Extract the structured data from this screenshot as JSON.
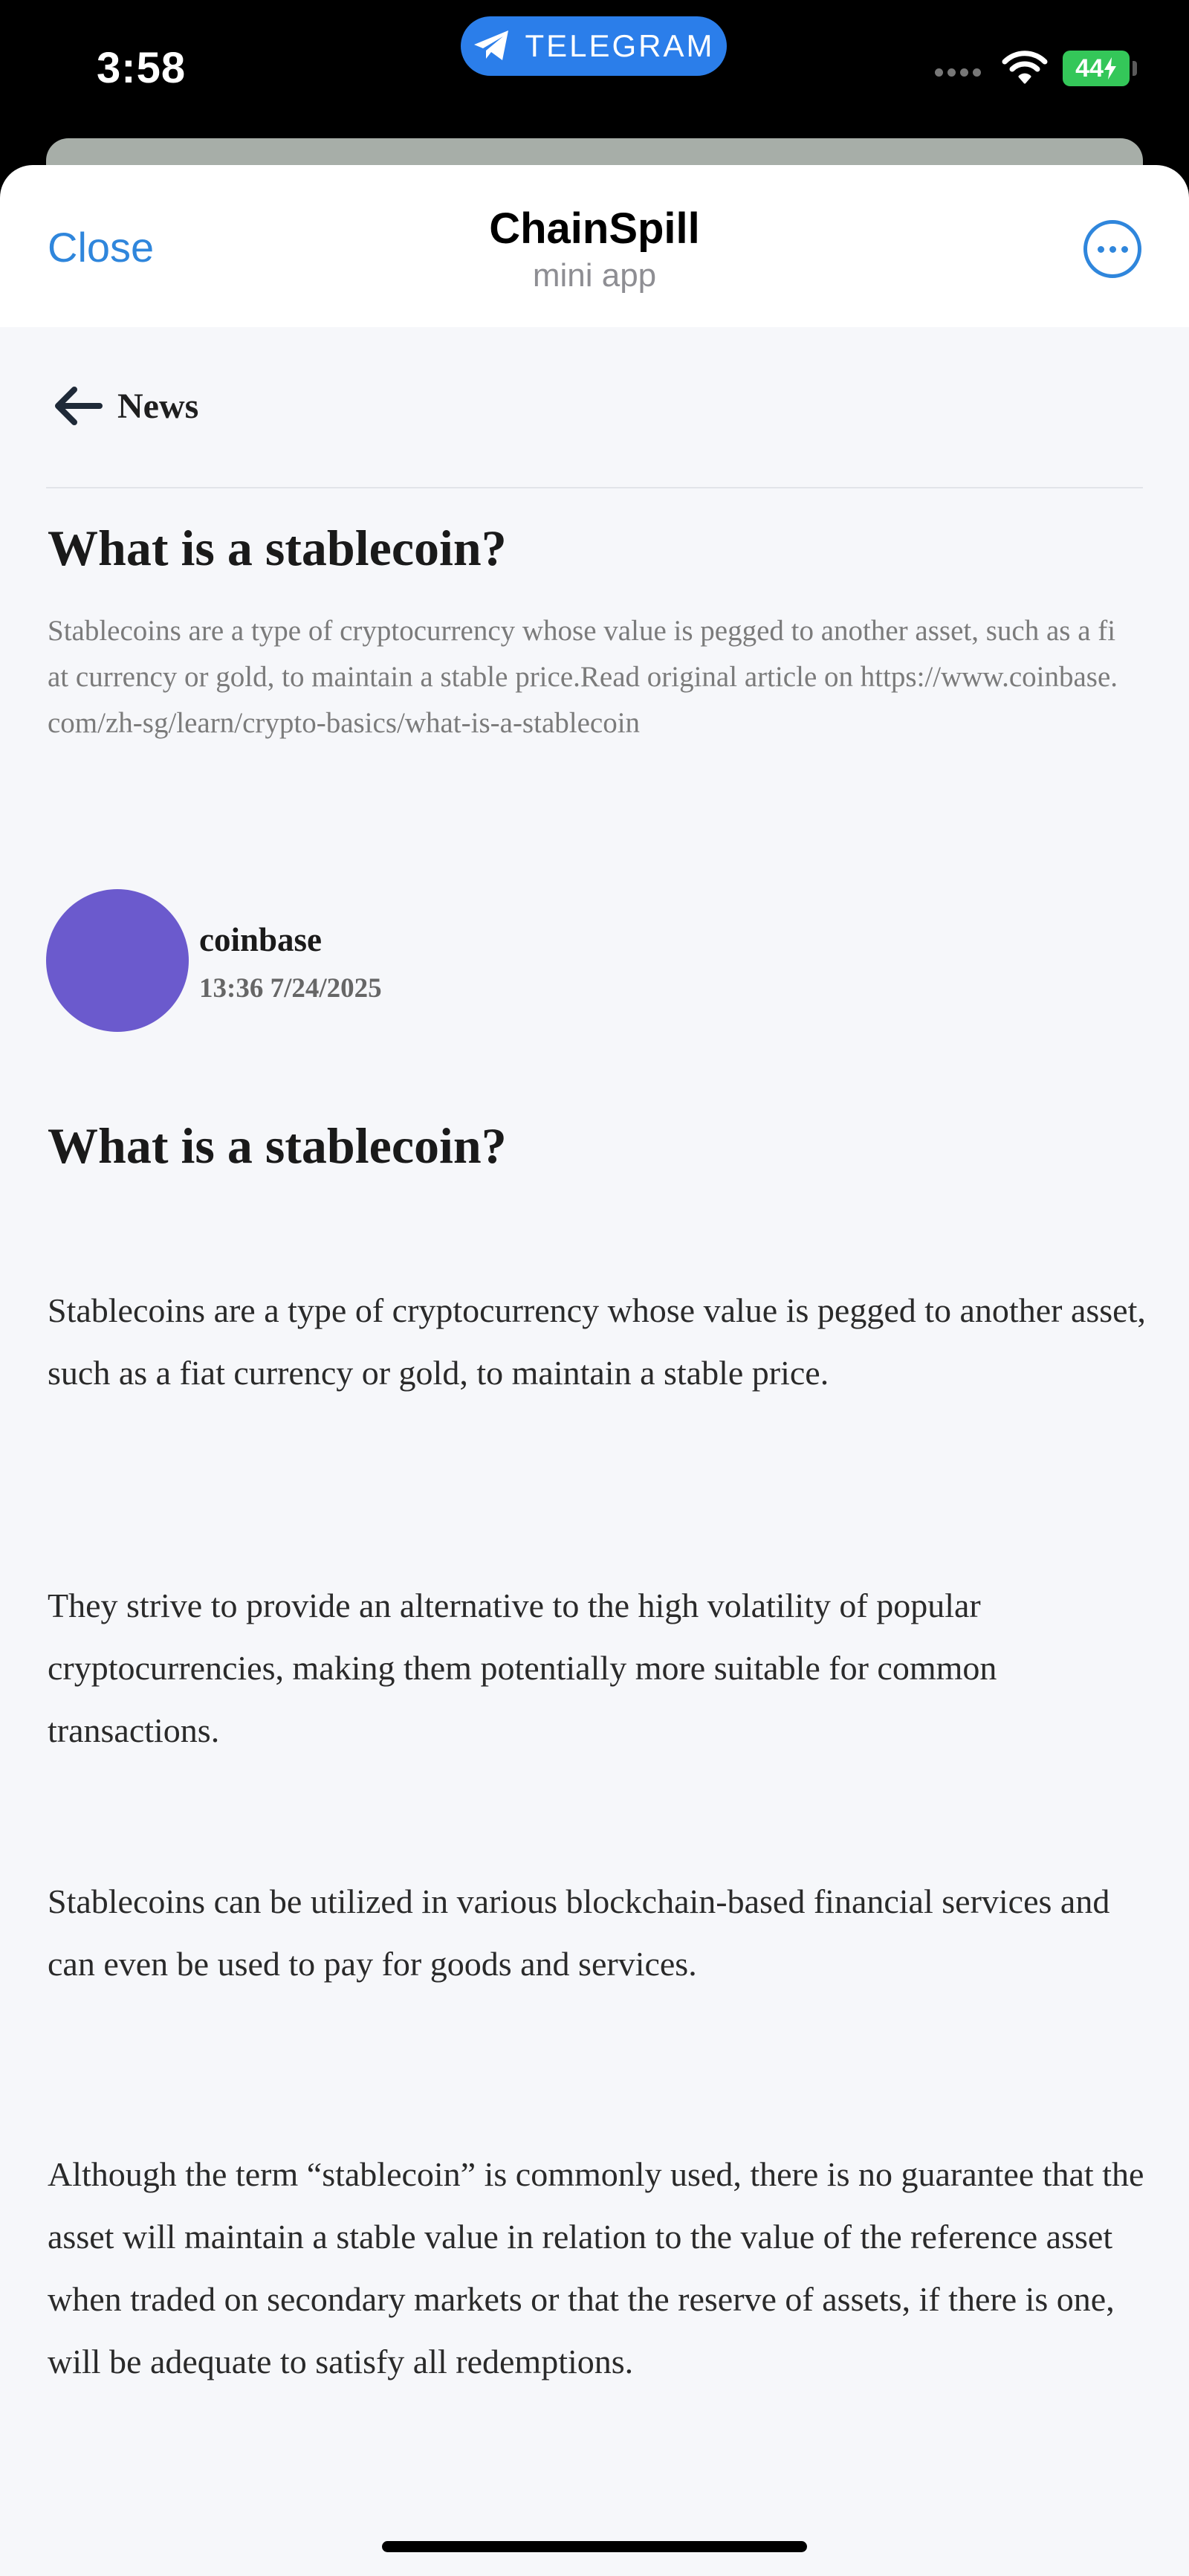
{
  "status_bar": {
    "time": "3:58",
    "app_pill_label": "TELEGRAM",
    "battery_level": "44"
  },
  "header": {
    "close_label": "Close",
    "title": "ChainSpill",
    "subtitle": "mini app",
    "more_icon": "more-horizontal-circle-icon"
  },
  "nav": {
    "back_label": "News",
    "back_icon": "arrow-left-icon"
  },
  "article": {
    "title": "What is a stablecoin?",
    "summary": "Stablecoins are a type of cryptocurrency whose value is pegged to another asset, such as a fiat currency or gold, to maintain a stable price.Read original article on https://www.coinbase.com/zh-sg/learn/crypto-basics/what-is-a-stablecoin",
    "author": {
      "name": "coinbase",
      "date": "13:36 7/24/2025",
      "avatar_color": "#6B5ACD"
    },
    "body_title": "What is a stablecoin?",
    "paragraphs": [
      "Stablecoins are a type of cryptocurrency whose value is pegged to another asset, such as a fiat currency or gold, to maintain a stable price.",
      "They strive to provide an alternative to the high volatility of popular cryptocurrencies, making them potentially more suitable for common transactions.",
      "Stablecoins can be utilized in various blockchain-based financial services and can even be used to pay for goods and services.",
      "Although the term “stablecoin” is commonly used, there is no guarantee that the asset will maintain a stable value in relation to the value of the reference asset when traded on secondary markets or that the reserve of assets, if there is one, will be adequate to satisfy all redemptions."
    ]
  },
  "colors": {
    "accent": "#2F86DC",
    "telegram_blue": "#2B7EEA",
    "battery_green": "#34C759",
    "content_background": "#F6F7FA"
  }
}
